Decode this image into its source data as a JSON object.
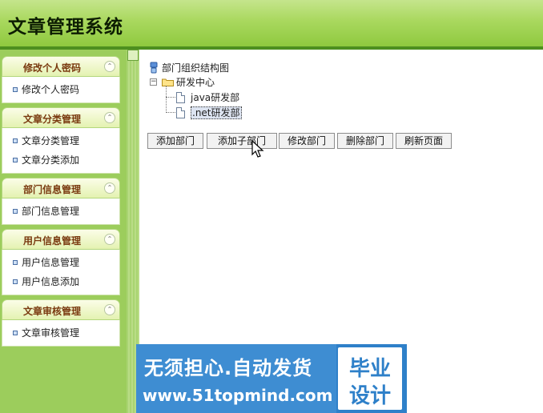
{
  "app": {
    "title": "文章管理系统"
  },
  "sidebar": {
    "sections": [
      {
        "title": "修改个人密码",
        "items": [
          "修改个人密码"
        ]
      },
      {
        "title": "文章分类管理",
        "items": [
          "文章分类管理",
          "文章分类添加"
        ]
      },
      {
        "title": "部门信息管理",
        "items": [
          "部门信息管理"
        ]
      },
      {
        "title": "用户信息管理",
        "items": [
          "用户信息管理",
          "用户信息添加"
        ]
      },
      {
        "title": "文章审核管理",
        "items": [
          "文章审核管理"
        ]
      }
    ],
    "collapse_glyph": "⌃"
  },
  "tree": {
    "root": "部门组织结构图",
    "node": "研发中心",
    "children": [
      "java研发部",
      ".net研发部"
    ],
    "selected": ".net研发部",
    "expander_glyph": "−"
  },
  "toolbar": {
    "buttons": [
      "添加部门",
      "添加子部门",
      "修改部门",
      "删除部门",
      "刷新页面"
    ]
  },
  "banner": {
    "slogan": "无须担心.自动发货",
    "url": "www.51topmind.com",
    "badge_line1": "毕业",
    "badge_line2": "设计"
  },
  "colors": {
    "header_green": "#8fc93f",
    "sidebar_green": "#9ccd5c",
    "section_title": "#7a3a10",
    "banner_blue": "#2e80c9"
  },
  "icons": [
    "collapse-icon",
    "bullet-icon",
    "org-root-icon",
    "folder-icon",
    "document-icon",
    "cursor-icon"
  ]
}
